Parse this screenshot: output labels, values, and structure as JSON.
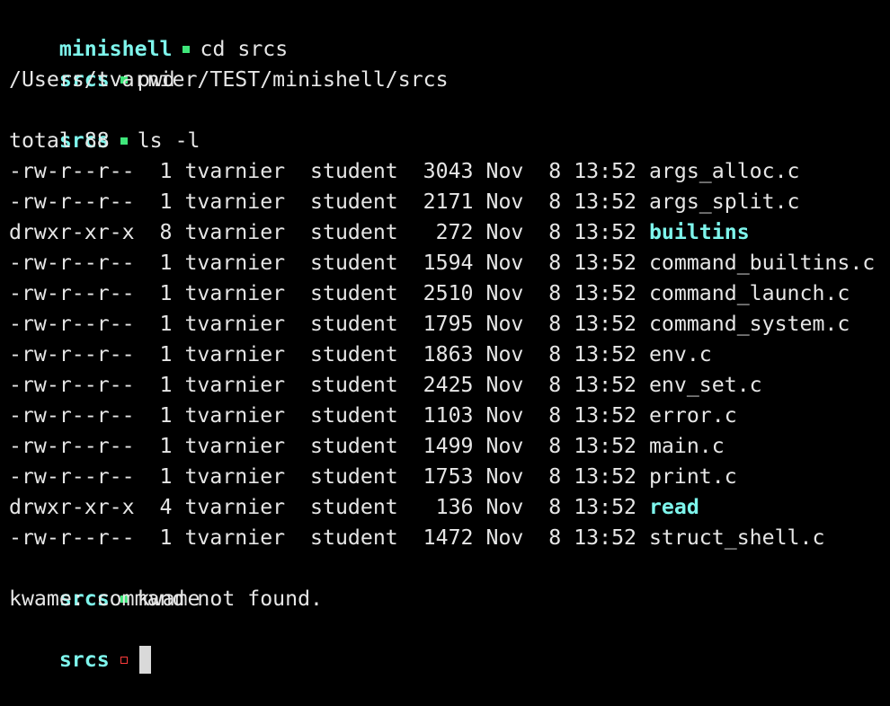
{
  "colors": {
    "background": "#000000",
    "text": "#e6e6e6",
    "prompt": "#7ef5ec",
    "status_ok": "#3fe67a",
    "status_fail": "#ff3b3b",
    "directory": "#7ef5ec",
    "cursor": "#d9d9d9"
  },
  "session": {
    "cmd1": {
      "dir": "minishell",
      "status": "ok",
      "command": "cd srcs"
    },
    "cmd2": {
      "dir": "srcs",
      "status": "ok",
      "command": "pwd"
    },
    "pwd_output": "/Users/tvarnier/TEST/minishell/srcs",
    "cmd3": {
      "dir": "srcs",
      "status": "ok",
      "command": "ls -l"
    },
    "total_line": "total 88",
    "listing": [
      {
        "perms": "-rw-r--r--",
        "links": "1",
        "owner": "tvarnier",
        "group": "student",
        "size": "3043",
        "month": "Nov",
        "day": "8",
        "time": "13:52",
        "name": "args_alloc.c",
        "is_dir": false
      },
      {
        "perms": "-rw-r--r--",
        "links": "1",
        "owner": "tvarnier",
        "group": "student",
        "size": "2171",
        "month": "Nov",
        "day": "8",
        "time": "13:52",
        "name": "args_split.c",
        "is_dir": false
      },
      {
        "perms": "drwxr-xr-x",
        "links": "8",
        "owner": "tvarnier",
        "group": "student",
        "size": "272",
        "month": "Nov",
        "day": "8",
        "time": "13:52",
        "name": "builtins",
        "is_dir": true
      },
      {
        "perms": "-rw-r--r--",
        "links": "1",
        "owner": "tvarnier",
        "group": "student",
        "size": "1594",
        "month": "Nov",
        "day": "8",
        "time": "13:52",
        "name": "command_builtins.c",
        "is_dir": false
      },
      {
        "perms": "-rw-r--r--",
        "links": "1",
        "owner": "tvarnier",
        "group": "student",
        "size": "2510",
        "month": "Nov",
        "day": "8",
        "time": "13:52",
        "name": "command_launch.c",
        "is_dir": false
      },
      {
        "perms": "-rw-r--r--",
        "links": "1",
        "owner": "tvarnier",
        "group": "student",
        "size": "1795",
        "month": "Nov",
        "day": "8",
        "time": "13:52",
        "name": "command_system.c",
        "is_dir": false
      },
      {
        "perms": "-rw-r--r--",
        "links": "1",
        "owner": "tvarnier",
        "group": "student",
        "size": "1863",
        "month": "Nov",
        "day": "8",
        "time": "13:52",
        "name": "env.c",
        "is_dir": false
      },
      {
        "perms": "-rw-r--r--",
        "links": "1",
        "owner": "tvarnier",
        "group": "student",
        "size": "2425",
        "month": "Nov",
        "day": "8",
        "time": "13:52",
        "name": "env_set.c",
        "is_dir": false
      },
      {
        "perms": "-rw-r--r--",
        "links": "1",
        "owner": "tvarnier",
        "group": "student",
        "size": "1103",
        "month": "Nov",
        "day": "8",
        "time": "13:52",
        "name": "error.c",
        "is_dir": false
      },
      {
        "perms": "-rw-r--r--",
        "links": "1",
        "owner": "tvarnier",
        "group": "student",
        "size": "1499",
        "month": "Nov",
        "day": "8",
        "time": "13:52",
        "name": "main.c",
        "is_dir": false
      },
      {
        "perms": "-rw-r--r--",
        "links": "1",
        "owner": "tvarnier",
        "group": "student",
        "size": "1753",
        "month": "Nov",
        "day": "8",
        "time": "13:52",
        "name": "print.c",
        "is_dir": false
      },
      {
        "perms": "drwxr-xr-x",
        "links": "4",
        "owner": "tvarnier",
        "group": "student",
        "size": "136",
        "month": "Nov",
        "day": "8",
        "time": "13:52",
        "name": "read",
        "is_dir": true
      },
      {
        "perms": "-rw-r--r--",
        "links": "1",
        "owner": "tvarnier",
        "group": "student",
        "size": "1472",
        "month": "Nov",
        "day": "8",
        "time": "13:52",
        "name": "struct_shell.c",
        "is_dir": false
      }
    ],
    "cmd4": {
      "dir": "srcs",
      "status": "ok",
      "command": "kwame"
    },
    "error_output": "kwame: command not found.",
    "current_prompt": {
      "dir": "srcs",
      "status": "fail",
      "input": ""
    }
  }
}
